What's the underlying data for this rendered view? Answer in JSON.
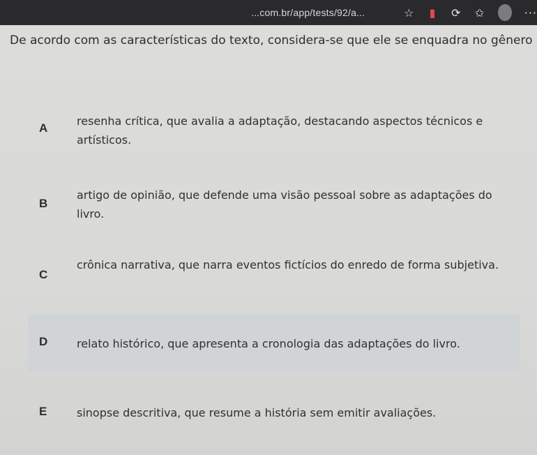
{
  "browser": {
    "url_text": "...com.br/app/tests/92/a..."
  },
  "question": {
    "text": "De acordo com as características do texto, considera-se que ele se enquadra no gênero"
  },
  "options": [
    {
      "letter": "A",
      "text": "resenha crítica, que avalia a adaptação, destacando aspectos técnicos e artísticos."
    },
    {
      "letter": "B",
      "text": "artigo de opinião, que defende uma visão pessoal sobre as adaptações do livro."
    },
    {
      "letter": "C",
      "text": "crônica narrativa, que narra eventos fictícios do enredo de forma subjetiva."
    },
    {
      "letter": "D",
      "text": "relato histórico, que apresenta a cronologia das adaptações do livro."
    },
    {
      "letter": "E",
      "text": "sinopse descritiva, que resume a história sem emitir avaliações."
    }
  ],
  "colors": {
    "topbar": "#2a2a2c",
    "page_bg": "#d9dad8",
    "highlight": "#d0d4d6",
    "text": "#2e2e2e"
  }
}
